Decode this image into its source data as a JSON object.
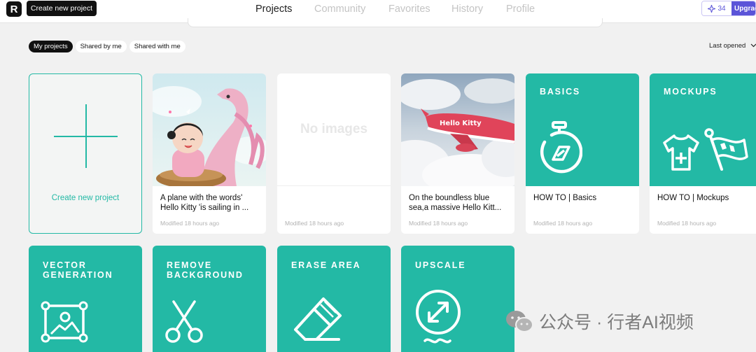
{
  "header": {
    "logo_text": "R",
    "create_button": "Create new project",
    "nav": [
      {
        "label": "Projects",
        "active": true
      },
      {
        "label": "Community",
        "active": false
      },
      {
        "label": "Favorites",
        "active": false
      },
      {
        "label": "History",
        "active": false
      },
      {
        "label": "Profile",
        "active": false
      }
    ],
    "credits": "34",
    "upgrade": "Upgrade"
  },
  "filters": {
    "tabs": [
      {
        "label": "My projects",
        "active": true
      },
      {
        "label": "Shared by me",
        "active": false
      },
      {
        "label": "Shared with me",
        "active": false
      }
    ],
    "sort": "Last opened"
  },
  "create_card_label": "Create new project",
  "projects": [
    {
      "title": "A plane with the words' Hello Kitty 'is sailing in ...",
      "modified": "Modified 18 hours ago",
      "thumb": "girl-and-dragon"
    },
    {
      "title": "",
      "modified": "Modified 18 hours ago",
      "thumb_text": "No images"
    },
    {
      "title": "On the boundless blue sea,a massive Hello Kitt...",
      "modified": "Modified 18 hours ago",
      "thumb": "hello-kitty-plane"
    },
    {
      "title": "HOW TO | Basics",
      "modified": "Modified 18 hours ago",
      "label": "BASICS"
    },
    {
      "title": "HOW TO | Mockups",
      "modified": "Modified 18 hours ago",
      "label": "MOCKUPS"
    }
  ],
  "tools": [
    {
      "label_line1": "VECTOR",
      "label_line2": "GENERATION"
    },
    {
      "label_line1": "REMOVE",
      "label_line2": "BACKGROUND"
    },
    {
      "label_line1": "ERASE AREA",
      "label_line2": ""
    },
    {
      "label_line1": "UPSCALE",
      "label_line2": ""
    }
  ],
  "watermark": "公众号 · 行者AI视频",
  "colors": {
    "teal": "#23b9a5",
    "upgrade_purple": "#5b54d8"
  }
}
